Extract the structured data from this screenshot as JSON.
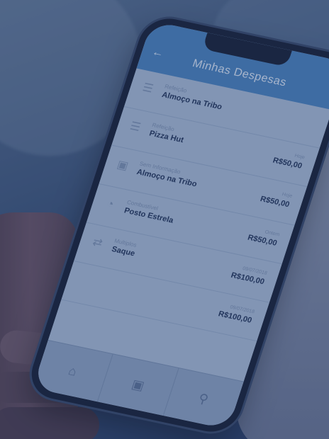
{
  "app": {
    "title": "Minhas Despesas",
    "back_icon": "arrow-left-icon"
  },
  "expenses": [
    {
      "icon": "utensils-icon",
      "category": "Refeição",
      "name": "Almoço na Tribo",
      "date": "",
      "value": ""
    },
    {
      "icon": "utensils-icon",
      "category": "Refeição",
      "name": "Pizza Hut",
      "date": "Hoje",
      "value": "R$50,00"
    },
    {
      "icon": "wallet-icon",
      "category": "Sem Informação",
      "name": "Almoço na Tribo",
      "date": "Hoje",
      "value": "R$50,00"
    },
    {
      "icon": "fuel-gauge-icon",
      "category": "Combustível",
      "name": "Posto Estrela",
      "date": "Ontem",
      "value": "R$50,00"
    },
    {
      "icon": "transfer-icon",
      "category": "Multiplos",
      "name": "Saque",
      "date": "09/07/2018",
      "value": "R$100,00"
    },
    {
      "icon": "",
      "category": "",
      "name": "",
      "date": "09/07/2018",
      "value": "R$100,00"
    }
  ],
  "tabbar": {
    "tabs": [
      {
        "icon": "home-icon"
      },
      {
        "icon": "camera-icon"
      },
      {
        "icon": "search-icon"
      }
    ]
  },
  "colors": {
    "header": "#4b83bd",
    "overlay": "#1c3462"
  }
}
